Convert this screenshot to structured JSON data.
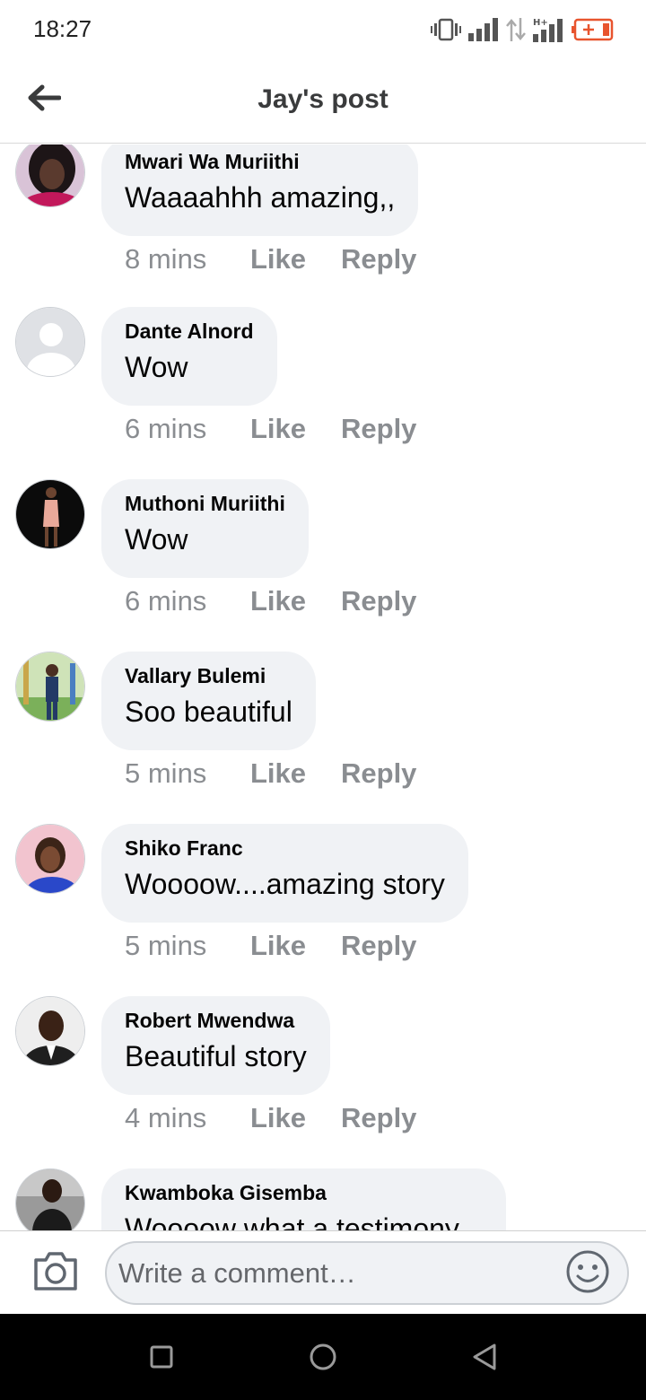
{
  "status_bar": {
    "time": "18:27",
    "icons": [
      "vibrate-icon",
      "signal-icon",
      "data-arrows-icon",
      "signal-hplus-icon",
      "battery-low-icon"
    ],
    "battery_color": "#e8542e"
  },
  "header": {
    "title": "Jay's post",
    "back_icon": "arrow-left-icon"
  },
  "comments": [
    {
      "author": "Mwari Wa Muriithi",
      "text": "Waaaahhh amazing,,",
      "time": "8 mins",
      "like_label": "Like",
      "reply_label": "Reply"
    },
    {
      "author": "Dante Alnord",
      "text": "Wow",
      "time": "6 mins",
      "like_label": "Like",
      "reply_label": "Reply"
    },
    {
      "author": "Muthoni Muriithi",
      "text": "Wow",
      "time": "6 mins",
      "like_label": "Like",
      "reply_label": "Reply"
    },
    {
      "author": "Vallary Bulemi",
      "text": "Soo beautiful",
      "time": "5 mins",
      "like_label": "Like",
      "reply_label": "Reply"
    },
    {
      "author": "Shiko Franc",
      "text": "Woooow....amazing story",
      "time": "5 mins",
      "like_label": "Like",
      "reply_label": "Reply"
    },
    {
      "author": "Robert Mwendwa",
      "text": "Beautiful story",
      "time": "4 mins",
      "like_label": "Like",
      "reply_label": "Reply"
    },
    {
      "author": "Kwamboka Gisemba",
      "text": "Woooow what a testimony",
      "time": "",
      "like_label": "",
      "reply_label": ""
    }
  ],
  "composer": {
    "placeholder": "Write a comment…",
    "camera_icon": "camera-icon",
    "emoji_icon": "emoji-icon"
  },
  "nav_bar": {
    "icons": [
      "recents-square-icon",
      "home-circle-icon",
      "back-triangle-icon"
    ]
  },
  "colors": {
    "bubble": "#f0f2f5",
    "meta_text": "#8a8d91",
    "title_text": "#3a3b3c"
  }
}
